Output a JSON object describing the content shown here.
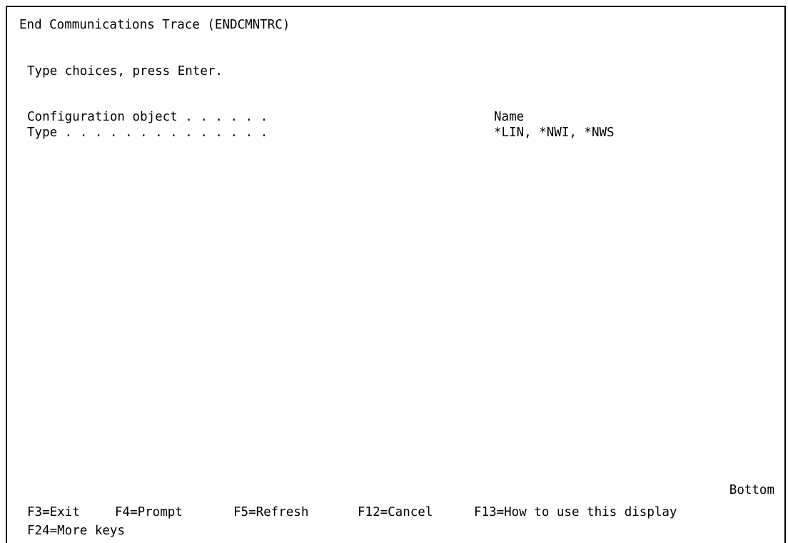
{
  "screen": {
    "title": "End Communications Trace (ENDCMNTRC)",
    "instruction": "Type choices, press Enter."
  },
  "fields": [
    {
      "label": "Configuration object . . . . . .",
      "value": "",
      "hint": "Name"
    },
    {
      "label": "Type . . . . . . . . . . . . . .",
      "value": "",
      "hint": "*LIN, *NWI, *NWS"
    }
  ],
  "status": {
    "position": "Bottom"
  },
  "function_keys": {
    "row1": [
      {
        "label": "F3=Exit"
      },
      {
        "label": "F4=Prompt"
      },
      {
        "label": "F5=Refresh"
      },
      {
        "label": "F12=Cancel"
      },
      {
        "label": "F13=How to use this display"
      }
    ],
    "row2": [
      {
        "label": "F24=More keys"
      }
    ]
  }
}
